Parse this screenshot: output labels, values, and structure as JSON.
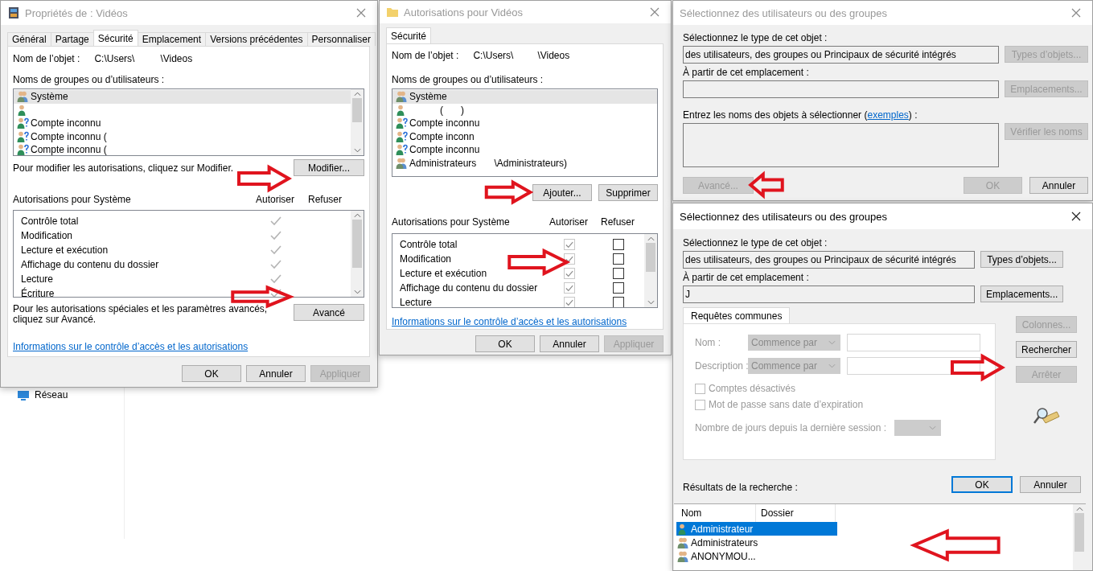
{
  "explorer": {
    "nav_item": "Réseau"
  },
  "properties": {
    "title": "Propriétés de : Vidéos",
    "active": false,
    "tabs": [
      {
        "label": "Général",
        "selected": false
      },
      {
        "label": "Partage",
        "selected": false
      },
      {
        "label": "Sécurité",
        "selected": true
      },
      {
        "label": "Emplacement",
        "selected": false
      },
      {
        "label": "Versions précédentes",
        "selected": false
      },
      {
        "label": "Personnaliser",
        "selected": false
      }
    ],
    "object_label": "Nom de l’objet :",
    "object_path_start": "C:\\Users\\",
    "object_path_end": "\\Videos",
    "users_label": "Noms de groupes ou d’utilisateurs :",
    "users": [
      {
        "kind": "group",
        "name": "Système",
        "selected": true
      },
      {
        "kind": "user",
        "selected": false
      },
      {
        "kind": "unknown",
        "name": "Compte inconnu",
        "selected": false
      },
      {
        "kind": "unknown",
        "name": "Compte inconnu (",
        "selected": false
      },
      {
        "kind": "unknown",
        "name": "Compte inconnu (",
        "selected": false
      }
    ],
    "edit_hint": "Pour modifier les autorisations, cliquez sur Modifier.",
    "edit_button": "Modifier...",
    "perm_label": "Autorisations pour Système",
    "allow_label": "Autoriser",
    "deny_label": "Refuser",
    "permissions": [
      {
        "name": "Contrôle total",
        "allow": true
      },
      {
        "name": "Modification",
        "allow": true
      },
      {
        "name": "Lecture et exécution",
        "allow": true
      },
      {
        "name": "Affichage du contenu du dossier",
        "allow": true
      },
      {
        "name": "Lecture",
        "allow": true
      },
      {
        "name": "Écriture",
        "allow": true
      }
    ],
    "advanced_hint": "Pour les autorisations spéciales et les paramètres avancés, cliquez sur Avancé.",
    "advanced_button": "Avancé",
    "link": "Informations sur le contrôle d’accès et les autorisations",
    "buttons": [
      {
        "label": "OK",
        "disabled": false
      },
      {
        "label": "Annuler",
        "disabled": false
      },
      {
        "label": "Appliquer",
        "disabled": true
      }
    ]
  },
  "permissions_dialog": {
    "title": "Autorisations pour Vidéos",
    "active": false,
    "tabs": [
      {
        "label": "Sécurité",
        "selected": true
      }
    ],
    "object_label": "Nom de l’objet :",
    "object_path_start": "C:\\Users\\",
    "object_path_end": "\\Videos",
    "users_label": "Noms de groupes ou d’utilisateurs :",
    "users": [
      {
        "kind": "group",
        "name": "Système",
        "selected": true
      },
      {
        "kind": "user",
        "name": "(",
        "suffix": ")",
        "selected": false
      },
      {
        "kind": "unknown",
        "name": "Compte inconnu",
        "selected": false
      },
      {
        "kind": "unknown",
        "name": "Compte inconn",
        "selected": false
      },
      {
        "kind": "unknown",
        "name": "Compte inconnu",
        "selected": false
      },
      {
        "kind": "group",
        "name": "Administrateurs",
        "suffix": "\\Administrateurs)",
        "selected": false
      }
    ],
    "user_buttons": [
      {
        "label": "Ajouter...",
        "disabled": false
      },
      {
        "label": "Supprimer",
        "disabled": false
      }
    ],
    "perm_label": "Autorisations pour Système",
    "allow_label": "Autoriser",
    "deny_label": "Refuser",
    "permissions": [
      {
        "name": "Contrôle total",
        "allow": true,
        "allow_disabled": true,
        "deny": false
      },
      {
        "name": "Modification",
        "allow": true,
        "allow_disabled": true,
        "deny": false
      },
      {
        "name": "Lecture et exécution",
        "allow": true,
        "allow_disabled": true,
        "deny": false
      },
      {
        "name": "Affichage du contenu du dossier",
        "allow": true,
        "allow_disabled": true,
        "deny": false
      },
      {
        "name": "Lecture",
        "allow": true,
        "allow_disabled": true,
        "deny": false
      }
    ],
    "link": "Informations sur le contrôle d’accès et les autorisations",
    "buttons": [
      {
        "label": "OK",
        "disabled": false
      },
      {
        "label": "Annuler",
        "disabled": false
      },
      {
        "label": "Appliquer",
        "disabled": true
      }
    ]
  },
  "select_dialog_back": {
    "title": "Sélectionnez des utilisateurs ou des groupes",
    "active": false,
    "type_label": "Sélectionnez le type de cet objet :",
    "type_value": "des utilisateurs, des groupes ou Principaux de sécurité intégrés",
    "types_button": {
      "label": "Types d’objets...",
      "disabled": true
    },
    "location_label": "À partir de cet emplacement :",
    "locations_button": {
      "label": "Emplacements...",
      "disabled": true
    },
    "names_label_start": "Entrez les noms des objets à sélectionner (",
    "names_link": "exemples",
    "names_label_end": ") :",
    "check_button": {
      "label": "Vérifier les noms",
      "disabled": true
    },
    "advanced_button": {
      "label": "Avancé...",
      "disabled": true
    },
    "buttons": [
      {
        "label": "OK",
        "disabled": true
      },
      {
        "label": "Annuler",
        "disabled": false
      }
    ]
  },
  "select_dialog": {
    "title": "Sélectionnez des utilisateurs ou des groupes",
    "active": true,
    "type_label": "Sélectionnez le type de cet objet :",
    "type_value": "des utilisateurs, des groupes ou Principaux de sécurité intégrés",
    "types_button": {
      "label": "Types d’objets...",
      "disabled": false
    },
    "location_label": "À partir de cet emplacement :",
    "location_value": "J",
    "locations_button": {
      "label": "Emplacements...",
      "disabled": false
    },
    "tabs": [
      {
        "label": "Requêtes communes",
        "selected": true
      }
    ],
    "queries": [
      {
        "label": "Nom :",
        "mode": "Commence par",
        "disabled": true
      },
      {
        "label": "Description :",
        "mode": "Commence par",
        "disabled": true
      }
    ],
    "options": [
      {
        "label": "Comptes désactivés",
        "checked": false,
        "disabled": true
      },
      {
        "label": "Mot de passe sans date d’expiration",
        "checked": false,
        "disabled": true
      }
    ],
    "days_label": "Nombre de jours depuis la dernière session :",
    "side_buttons": [
      {
        "label": "Colonnes...",
        "disabled": true
      },
      {
        "label": "Rechercher",
        "disabled": false
      },
      {
        "label": "Arrêter",
        "disabled": true
      }
    ],
    "buttons": [
      {
        "label": "OK",
        "disabled": false,
        "default": true
      },
      {
        "label": "Annuler",
        "disabled": false,
        "default": false
      }
    ],
    "results_label": "Résultats de la recherche :",
    "columns": [
      "Nom",
      "Dossier"
    ],
    "results": [
      {
        "kind": "user",
        "name": "Administrateur",
        "selected": true
      },
      {
        "kind": "group",
        "name": "Administrateurs",
        "selected": false
      },
      {
        "kind": "group",
        "name": "ANONYMOU...",
        "selected": false
      }
    ]
  }
}
